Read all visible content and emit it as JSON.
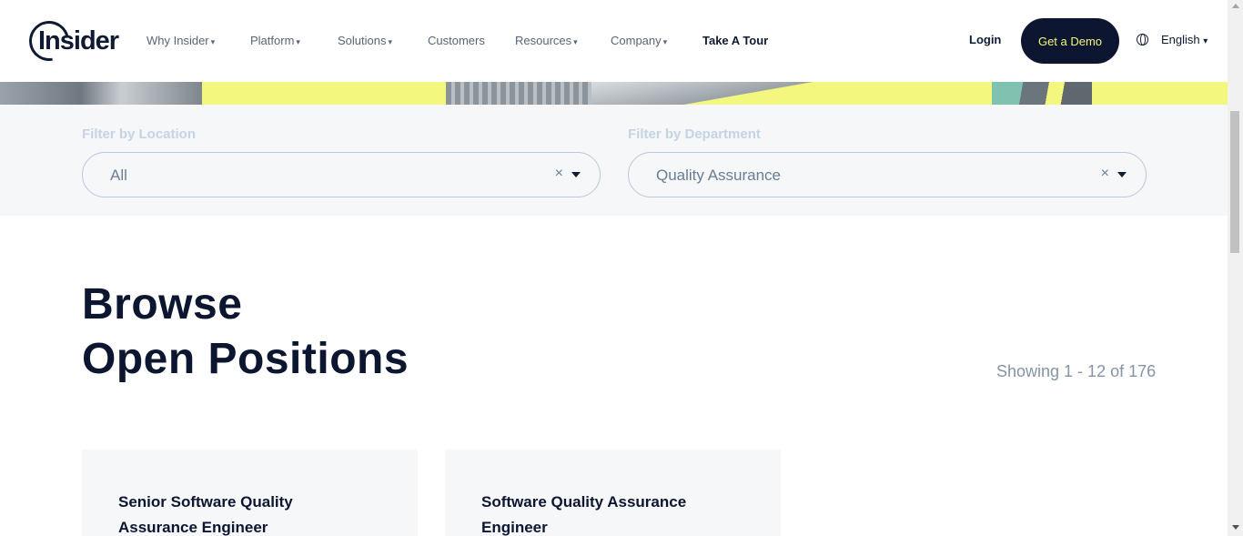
{
  "header": {
    "logo_text": "Insider",
    "nav": [
      {
        "label": "Why Insider",
        "has_caret": true
      },
      {
        "label": "Platform",
        "has_caret": true
      },
      {
        "label": "Solutions",
        "has_caret": true
      },
      {
        "label": "Customers",
        "has_caret": false
      },
      {
        "label": "Resources",
        "has_caret": true
      },
      {
        "label": "Company",
        "has_caret": true
      },
      {
        "label": "Take A Tour",
        "has_caret": false
      }
    ],
    "caret_glyph": "▾",
    "login_label": "Login",
    "demo_label": "Get a Demo",
    "language_label": "English",
    "language_caret": "▾"
  },
  "filters": {
    "location": {
      "label": "Filter by Location",
      "value": "All",
      "clear_glyph": "×"
    },
    "department": {
      "label": "Filter by Department",
      "value": "Quality Assurance",
      "clear_glyph": "×"
    }
  },
  "main": {
    "title_line1": "Browse",
    "title_line2": "Open Positions",
    "showing": "Showing 1 - 12 of 176"
  },
  "jobs": [
    {
      "title": "Senior Software Quality Assurance Engineer"
    },
    {
      "title": "Software Quality Assurance Engineer"
    }
  ],
  "colors": {
    "brand_navy": "#0c1631",
    "accent_yellow": "#f4f77d",
    "filter_bg": "#f5f7f9"
  }
}
